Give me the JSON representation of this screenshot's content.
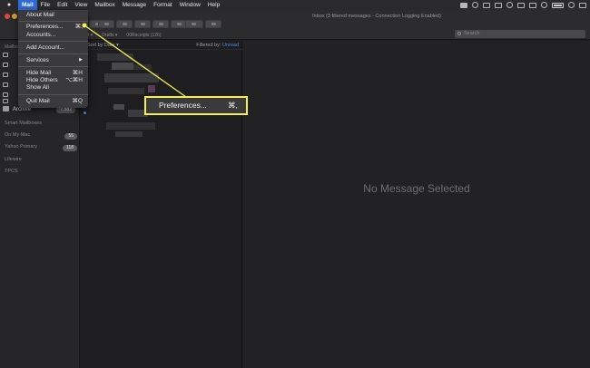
{
  "menubar": {
    "app": "Mail",
    "items": [
      "File",
      "Edit",
      "View",
      "Mailbox",
      "Message",
      "Format",
      "Window",
      "Help"
    ]
  },
  "window": {
    "title": "Inbox (3 filtered messages - Connection Logging Enabled)",
    "search_placeholder": "Search",
    "favorites": [
      "Sent ▾",
      "Drafts ▾",
      "00Receipts (126)"
    ]
  },
  "mail_menu": {
    "items": [
      {
        "label": "About Mail",
        "shortcut": ""
      },
      {
        "label": "Preferences...",
        "shortcut": "⌘,"
      },
      {
        "label": "Accounts...",
        "shortcut": ""
      },
      {
        "label": "Add Account...",
        "shortcut": ""
      },
      {
        "label": "Services",
        "shortcut": "▶"
      },
      {
        "label": "Hide Mail",
        "shortcut": "⌘H"
      },
      {
        "label": "Hide Others",
        "shortcut": "⌥⌘H"
      },
      {
        "label": "Show All",
        "shortcut": ""
      },
      {
        "label": "Quit Mail",
        "shortcut": "⌘Q"
      }
    ]
  },
  "sidebar": {
    "header": "Mailbox",
    "archive": {
      "label": "Archive",
      "count": "7,582"
    },
    "smart_mailboxes_label": "Smart Mailboxes",
    "sections": [
      {
        "label": "On My Mac",
        "count": "55"
      },
      {
        "label": "Yahoo Primary",
        "count": "118"
      },
      {
        "label": "Lifewire",
        "count": ""
      },
      {
        "label": "TPCS",
        "count": ""
      }
    ]
  },
  "list": {
    "sort_label": "Sort by Date ▾",
    "filter_label": "Filtered by:",
    "filter_value": "Unread"
  },
  "detail": {
    "empty_text": "No Message Selected"
  },
  "callout": {
    "label": "Preferences...",
    "shortcut": "⌘,"
  },
  "colors": {
    "highlight": "#f3ef55",
    "menu_accent": "#2f6bd8",
    "link_blue": "#3d8ee6"
  }
}
